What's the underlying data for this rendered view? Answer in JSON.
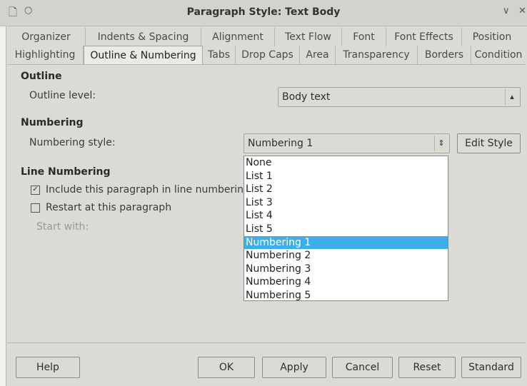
{
  "window": {
    "title": "Paragraph Style: Text Body"
  },
  "tabs_row1": [
    "Organizer",
    "Indents & Spacing",
    "Alignment",
    "Text Flow",
    "Font",
    "Font Effects",
    "Position"
  ],
  "tabs_row2": [
    "Highlighting",
    "Outline & Numbering",
    "Tabs",
    "Drop Caps",
    "Area",
    "Transparency",
    "Borders",
    "Condition"
  ],
  "active_tab": "Outline & Numbering",
  "outline": {
    "heading": "Outline",
    "level_label": "Outline level:",
    "level_value": "Body text"
  },
  "numbering": {
    "heading": "Numbering",
    "style_label": "Numbering style:",
    "style_value": "Numbering 1",
    "edit_style": "Edit Style",
    "options": [
      "None",
      "List 1",
      "List 2",
      "List 3",
      "List 4",
      "List 5",
      "Numbering 1",
      "Numbering 2",
      "Numbering 3",
      "Numbering 4",
      "Numbering 5"
    ],
    "selected_index": 6
  },
  "line_numbering": {
    "heading": "Line Numbering",
    "include_label": "Include this paragraph in line numberin",
    "include_checked": true,
    "restart_label": "Restart at this paragraph",
    "restart_checked": false,
    "start_with_label": "Start with:"
  },
  "buttons": {
    "help": "Help",
    "ok": "OK",
    "apply": "Apply",
    "cancel": "Cancel",
    "reset": "Reset",
    "standard": "Standard"
  },
  "colors": {
    "selection": "#3daee9",
    "dialog_bg": "#dcdad5"
  }
}
